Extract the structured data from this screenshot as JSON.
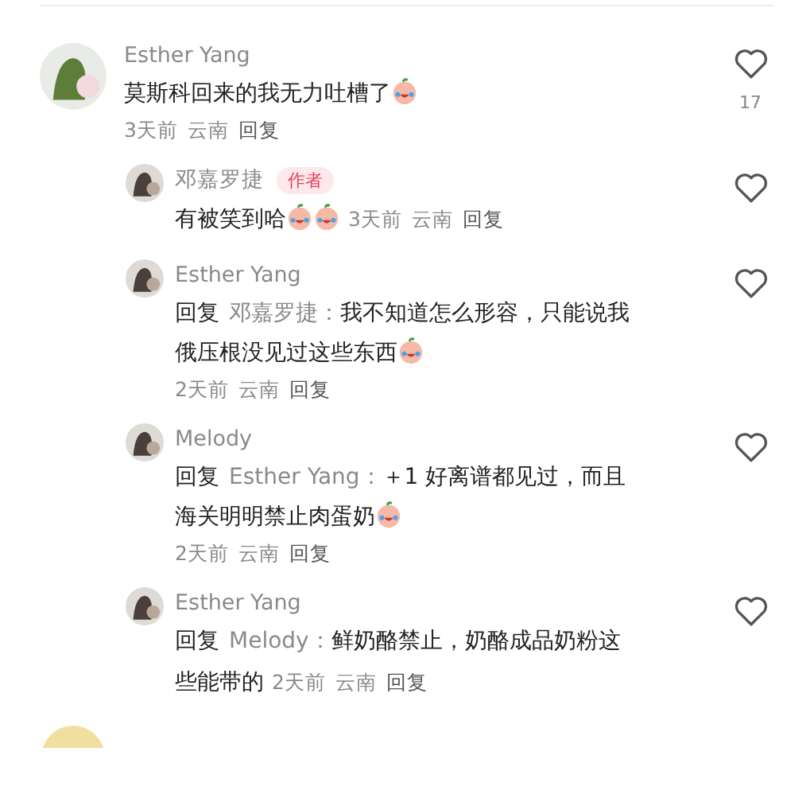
{
  "comments": [
    {
      "author": "Esther Yang",
      "parts": [
        {
          "kind": "text",
          "text": "莫斯科回来的我无力吐槽了"
        },
        {
          "kind": "emoji"
        }
      ],
      "date": "3天前",
      "location": "云南",
      "reply": "回复",
      "likes": "17",
      "meta_inline": false,
      "replies": [
        {
          "author": "邓嘉罗捷",
          "badge": "作者",
          "parts": [
            {
              "kind": "text",
              "text": "有被笑到哈"
            },
            {
              "kind": "emoji"
            },
            {
              "kind": "emoji"
            }
          ],
          "date": "3天前",
          "location": "云南",
          "reply": "回复",
          "meta_inline": true
        },
        {
          "author": "Esther Yang",
          "reply_label": "回复",
          "reply_to": "邓嘉罗捷：",
          "parts": [
            {
              "kind": "text",
              "text": "我不知道怎么形容，只能说我俄压根没见过这些东西"
            },
            {
              "kind": "emoji"
            }
          ],
          "date": "2天前",
          "location": "云南",
          "reply": "回复",
          "meta_inline": false
        },
        {
          "author": "Melody",
          "reply_label": "回复",
          "reply_to": "Esther Yang：",
          "parts": [
            {
              "kind": "text",
              "text": "＋1 好离谱都见过，而且海关明明禁止肉蛋奶"
            },
            {
              "kind": "emoji"
            }
          ],
          "date": "2天前",
          "location": "云南",
          "reply": "回复",
          "meta_inline": false
        },
        {
          "author": "Esther Yang",
          "reply_label": "回复",
          "reply_to": "Melody：",
          "parts": [
            {
              "kind": "text",
              "text": "鲜奶酪禁止，奶酪成品奶粉这些能带的"
            }
          ],
          "date": "2天前",
          "location": "云南",
          "reply": "回复",
          "meta_inline": true
        }
      ]
    }
  ]
}
